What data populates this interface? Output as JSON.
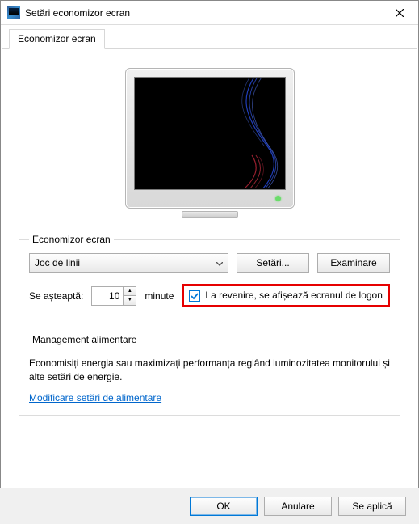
{
  "window": {
    "title": "Setări economizor ecran"
  },
  "tab": {
    "label": "Economizor ecran"
  },
  "screensaver_group": {
    "legend": "Economizor ecran",
    "selected": "Joc de linii",
    "settings_btn": "Setări...",
    "preview_btn": "Examinare",
    "wait_label": "Se așteaptă:",
    "wait_value": "10",
    "wait_unit": "minute",
    "resume_checkbox": "La revenire, se afișează ecranul de logon",
    "resume_checked": true
  },
  "power_group": {
    "legend": "Management alimentare",
    "text": "Economisiți energia sau maximizați performanța reglând luminozitatea monitorului și alte setări de energie.",
    "link": "Modificare setări de alimentare"
  },
  "footer": {
    "ok": "OK",
    "cancel": "Anulare",
    "apply": "Se aplică"
  }
}
